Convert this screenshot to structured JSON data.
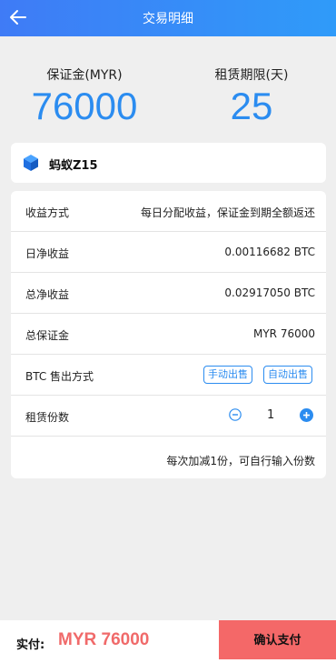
{
  "header": {
    "title": "交易明细",
    "back_icon": "back-arrow-icon"
  },
  "stats": {
    "margin_label": "保证金(MYR)",
    "margin_value": "76000",
    "period_label": "租赁期限(天)",
    "period_value": "25"
  },
  "product": {
    "name": "蚂蚁Z15",
    "icon": "cube-icon"
  },
  "details": {
    "income_method": {
      "label": "收益方式",
      "value": "每日分配收益，保证金到期全额返还"
    },
    "daily_income": {
      "label": "日净收益",
      "value": "0.00116682 BTC"
    },
    "total_income": {
      "label": "总净收益",
      "value": "0.02917050 BTC"
    },
    "total_margin": {
      "label": "总保证金",
      "value": "MYR 76000"
    },
    "sell_method": {
      "label": "BTC 售出方式",
      "manual": "手动出售",
      "auto": "自动出售"
    },
    "quantity": {
      "label": "租赁份数",
      "value": "1"
    },
    "hint": "每次加减1份，可自行输入份数"
  },
  "footer": {
    "pay_label": "实付:",
    "pay_amount": "MYR 76000",
    "confirm_label": "确认支付"
  },
  "colors": {
    "accent": "#2b8cf0",
    "header_start": "#3f7bf6",
    "header_end": "#2f9bf9",
    "confirm": "#f46868",
    "amount": "#f06a6a"
  }
}
